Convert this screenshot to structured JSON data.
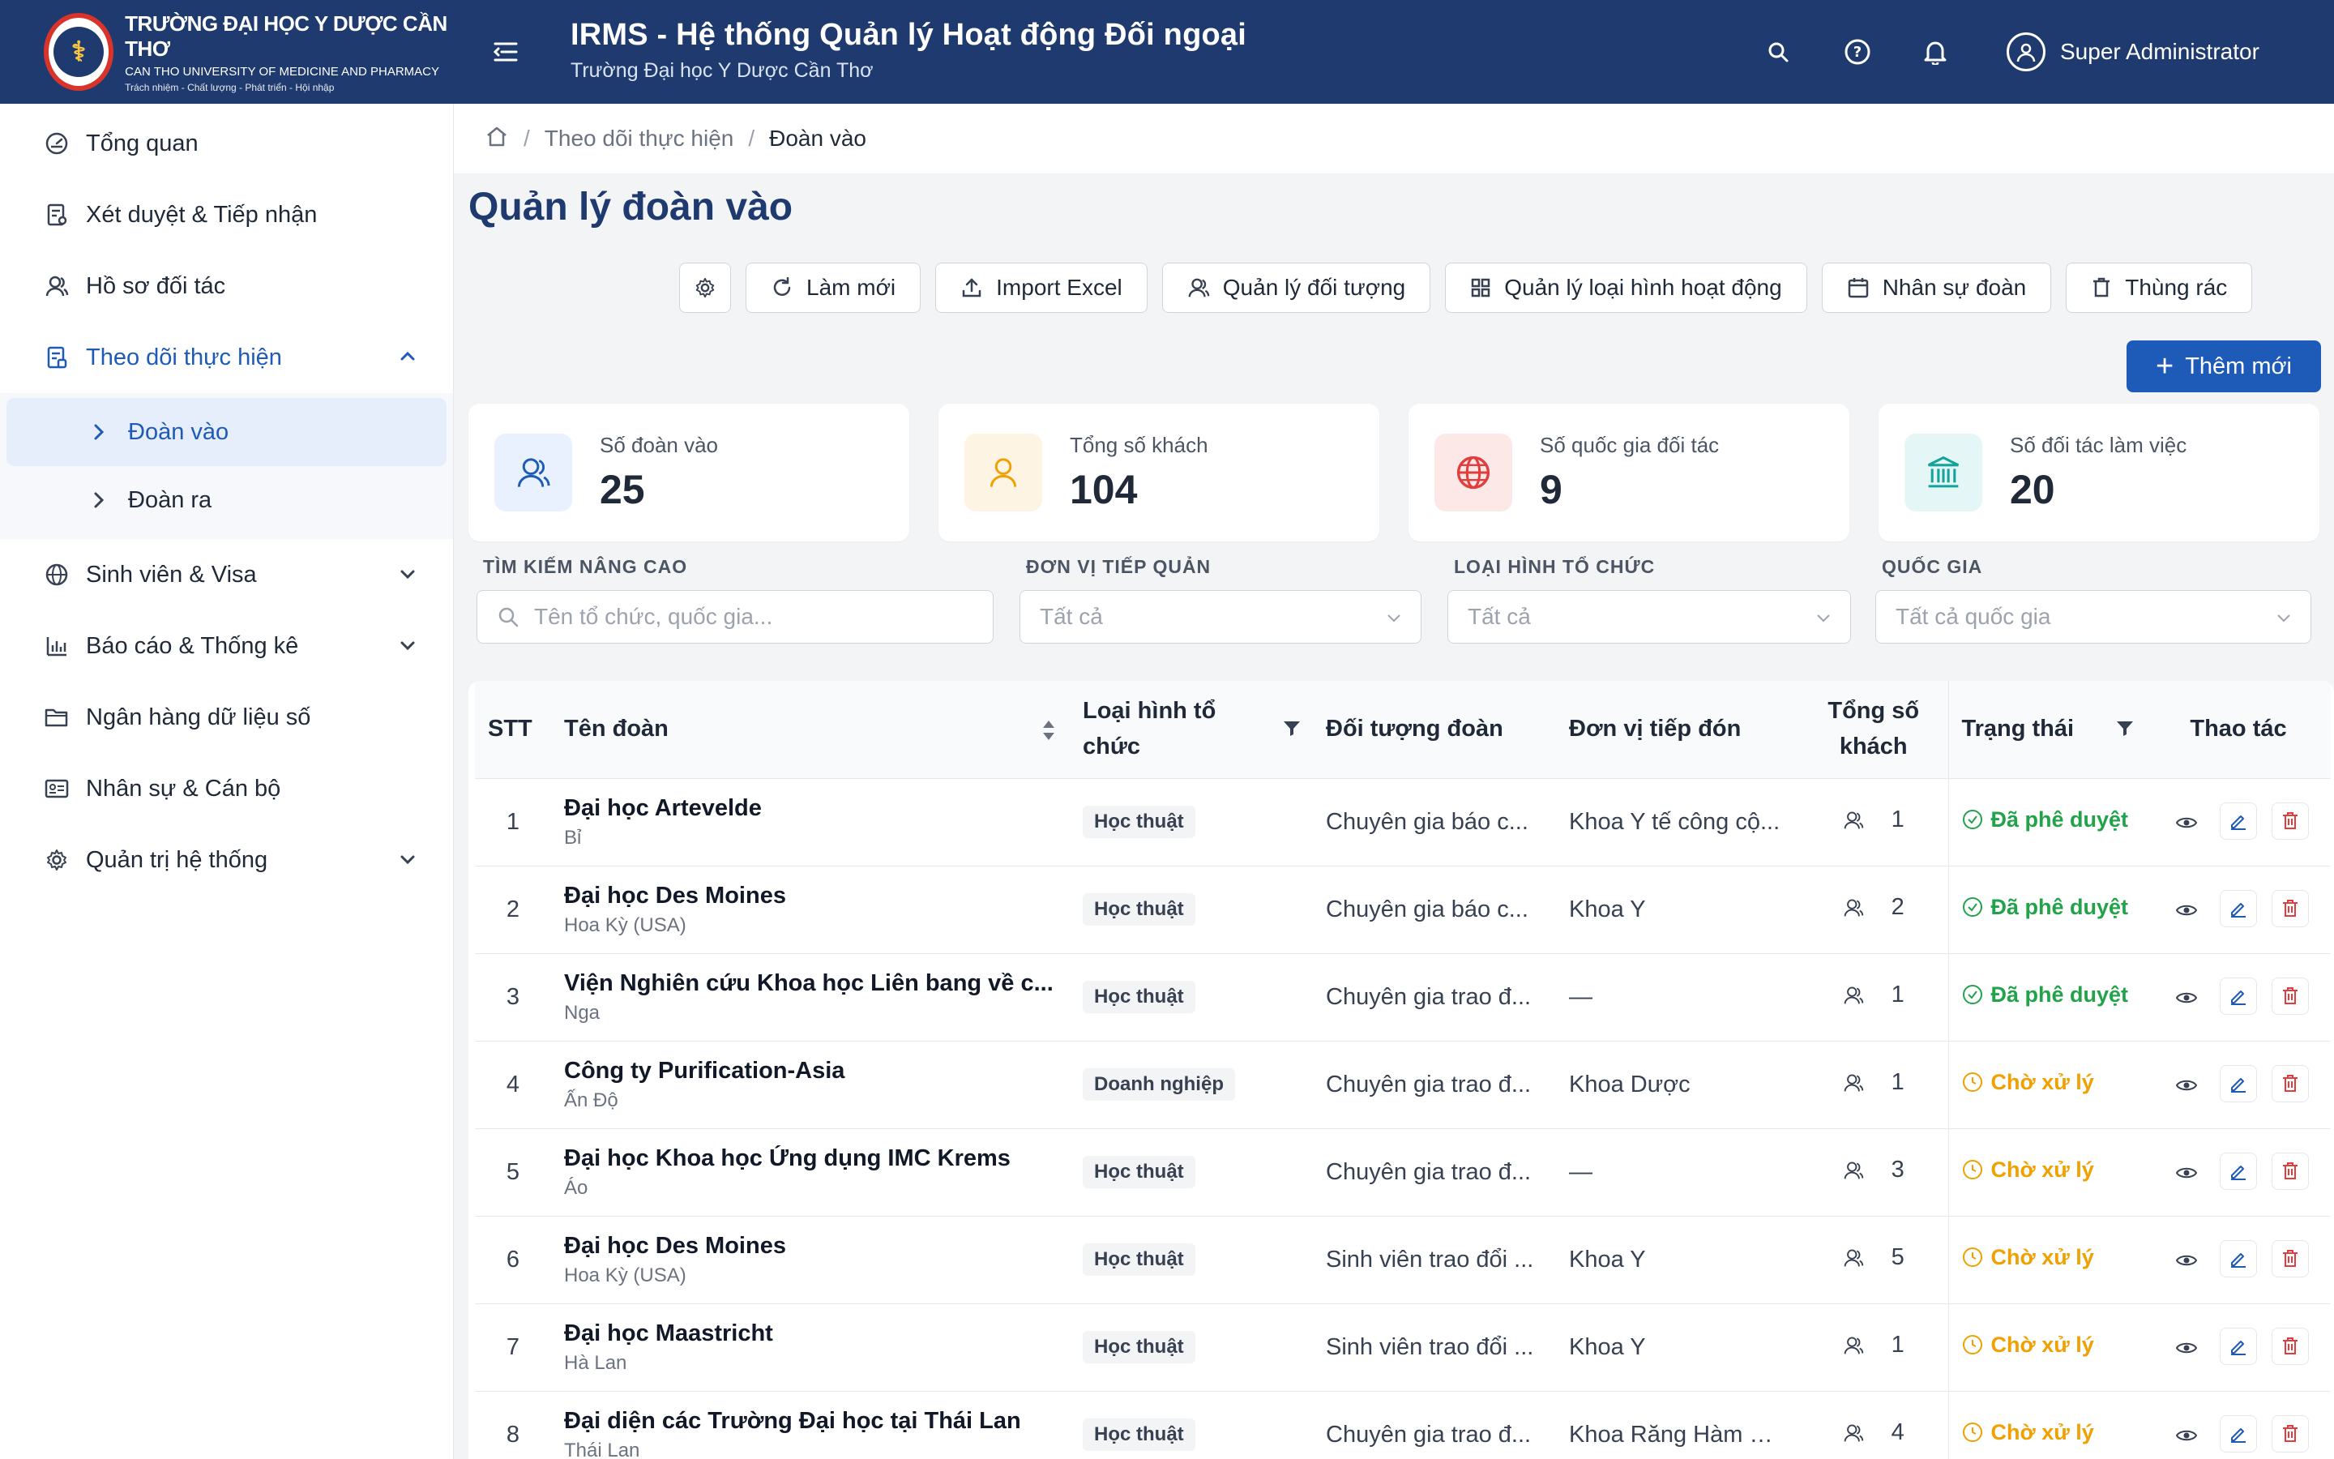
{
  "header": {
    "brand_line1": "TRƯỜNG ĐẠI HỌC Y DƯỢC CẦN THƠ",
    "brand_line2": "CAN THO UNIVERSITY OF MEDICINE AND PHARMACY",
    "brand_line3": "Trách nhiệm - Chất lượng - Phát triển - Hội nhập",
    "app_title": "IRMS - Hệ thống Quản lý Hoạt động Đối ngoại",
    "app_subtitle": "Trường Đại học Y Dược Cần Thơ",
    "user_name": "Super Administrator"
  },
  "sidebar": {
    "items": [
      {
        "label": "Tổng quan",
        "icon": "dashboard-icon"
      },
      {
        "label": "Xét duyệt & Tiếp nhận",
        "icon": "approval-icon"
      },
      {
        "label": "Hồ sơ đối tác",
        "icon": "partner-icon"
      },
      {
        "label": "Theo dõi thực hiện",
        "icon": "tracking-icon"
      },
      {
        "label": "Sinh viên & Visa",
        "icon": "globe-icon"
      },
      {
        "label": "Báo cáo & Thống kê",
        "icon": "bar-chart-icon"
      },
      {
        "label": "Ngân hàng dữ liệu số",
        "icon": "folder-icon"
      },
      {
        "label": "Nhân sự & Cán bộ",
        "icon": "id-card-icon"
      },
      {
        "label": "Quản trị hệ thống",
        "icon": "gear-icon"
      }
    ],
    "subitems": [
      {
        "label": "Đoàn vào"
      },
      {
        "label": "Đoàn ra"
      }
    ]
  },
  "breadcrumb": {
    "parent": "Theo dõi thực hiện",
    "current": "Đoàn vào"
  },
  "page": {
    "title": "Quản lý đoàn vào"
  },
  "toolbar": {
    "refresh": "Làm mới",
    "import": "Import Excel",
    "objects": "Quản lý đối tượng",
    "activity_types": "Quản lý loại hình hoạt động",
    "staff": "Nhân sự đoàn",
    "trash": "Thùng rác",
    "add": "Thêm mới"
  },
  "stats": [
    {
      "label": "Số đoàn vào",
      "value": "25"
    },
    {
      "label": "Tổng số khách",
      "value": "104"
    },
    {
      "label": "Số quốc gia đối tác",
      "value": "9"
    },
    {
      "label": "Số đối tác làm việc",
      "value": "20"
    }
  ],
  "filters": {
    "search_label": "TÌM KIẾM NÂNG CAO",
    "search_placeholder": "Tên tổ chức, quốc gia...",
    "unit_label": "ĐƠN VỊ TIẾP QUẢN",
    "unit_value": "Tất cả",
    "type_label": "LOẠI HÌNH TỔ CHỨC",
    "type_value": "Tất cả",
    "country_label": "QUỐC GIA",
    "country_value": "Tất cả quốc gia"
  },
  "table": {
    "headers": {
      "stt": "STT",
      "name": "Tên đoàn",
      "type": "Loại hình tổ chức",
      "object": "Đối tượng đoàn",
      "unit": "Đơn vị tiếp đón",
      "guests": "Tổng số khách",
      "status": "Trạng thái",
      "actions": "Thao tác"
    },
    "rows": [
      {
        "stt": "1",
        "name": "Đại học Artevelde",
        "country": "Bỉ",
        "type": "Học thuật",
        "object": "Chuyên gia báo c...",
        "unit": "Khoa Y tế công cộ...",
        "guests": "1",
        "status": "Đã phê duyệt"
      },
      {
        "stt": "2",
        "name": "Đại học Des Moines",
        "country": "Hoa Kỳ (USA)",
        "type": "Học thuật",
        "object": "Chuyên gia báo c...",
        "unit": "Khoa Y",
        "guests": "2",
        "status": "Đã phê duyệt"
      },
      {
        "stt": "3",
        "name": "Viện Nghiên cứu Khoa học Liên bang về c...",
        "country": "Nga",
        "type": "Học thuật",
        "object": "Chuyên gia trao đ...",
        "unit": "—",
        "guests": "1",
        "status": "Đã phê duyệt"
      },
      {
        "stt": "4",
        "name": "Công ty Purification-Asia",
        "country": "Ấn Độ",
        "type": "Doanh nghiệp",
        "object": "Chuyên gia trao đ...",
        "unit": "Khoa Dược",
        "guests": "1",
        "status": "Chờ xử lý"
      },
      {
        "stt": "5",
        "name": "Đại học Khoa học Ứng dụng IMC Krems",
        "country": "Áo",
        "type": "Học thuật",
        "object": "Chuyên gia trao đ...",
        "unit": "—",
        "guests": "3",
        "status": "Chờ xử lý"
      },
      {
        "stt": "6",
        "name": "Đại học Des Moines",
        "country": "Hoa Kỳ (USA)",
        "type": "Học thuật",
        "object": "Sinh viên trao đổi ...",
        "unit": "Khoa Y",
        "guests": "5",
        "status": "Chờ xử lý"
      },
      {
        "stt": "7",
        "name": "Đại học Maastricht",
        "country": "Hà Lan",
        "type": "Học thuật",
        "object": "Sinh viên trao đổi ...",
        "unit": "Khoa Y",
        "guests": "1",
        "status": "Chờ xử lý"
      },
      {
        "stt": "8",
        "name": "Đại diện các Trường Đại học tại Thái Lan",
        "country": "Thái Lan",
        "type": "Học thuật",
        "object": "Chuyên gia trao đ...",
        "unit": "Khoa Răng Hàm M...",
        "guests": "4",
        "status": "Chờ xử lý"
      }
    ]
  },
  "colors": {
    "primary": "#1e5bb8",
    "header_bg": "#1e3a6e",
    "approved": "#22a34a",
    "pending": "#f0a000",
    "danger": "#e23d3d"
  }
}
